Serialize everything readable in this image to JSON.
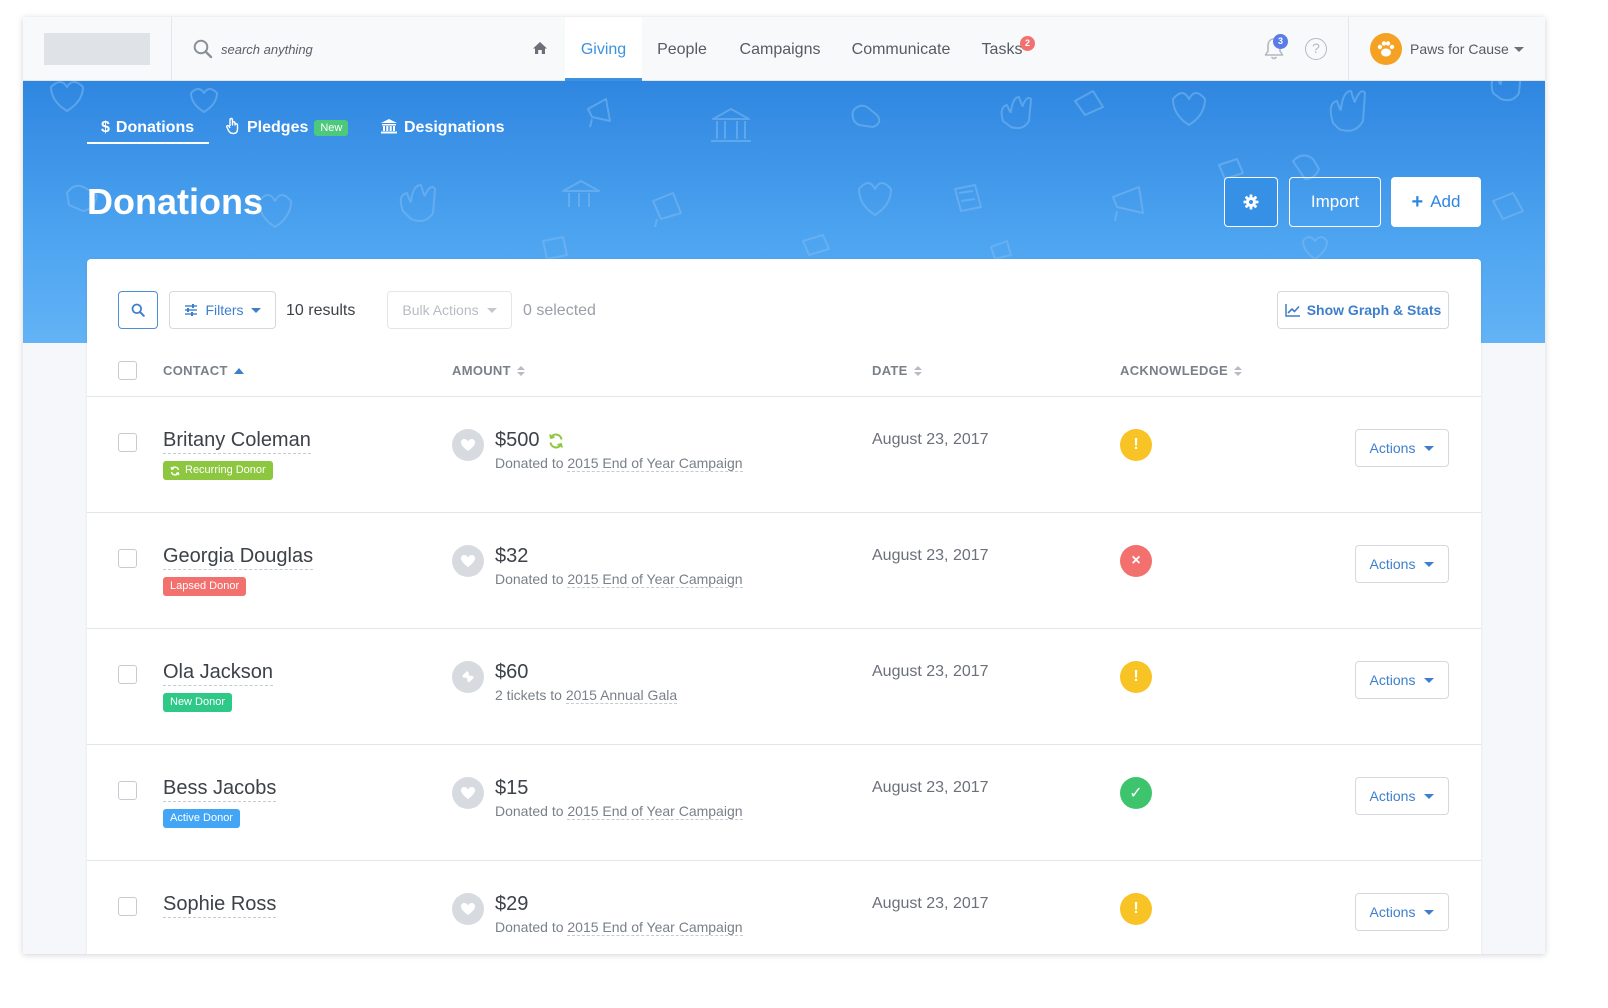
{
  "search": {
    "placeholder": "search anything"
  },
  "nav": {
    "tabs": [
      {
        "label": "Giving",
        "active": true
      },
      {
        "label": "People"
      },
      {
        "label": "Campaigns"
      },
      {
        "label": "Communicate"
      },
      {
        "label": "Tasks",
        "badge": "2"
      }
    ],
    "notifications_badge": "3",
    "help_symbol": "?",
    "org_name": "Paws for Cause"
  },
  "subtabs": {
    "donations": "Donations",
    "donations_symbol": "$",
    "pledges": "Pledges",
    "pledges_badge": "New",
    "designations": "Designations"
  },
  "page": {
    "title": "Donations",
    "import_label": "Import",
    "add_label": "Add",
    "add_symbol": "+"
  },
  "toolbar": {
    "filters_label": "Filters",
    "results_text": "10 results",
    "bulk_label": "Bulk Actions",
    "selected_text": "0 selected",
    "graph_label": "Show Graph & Stats"
  },
  "table": {
    "headers": {
      "contact": "CONTACT",
      "amount": "AMOUNT",
      "date": "DATE",
      "acknowledge": "ACKNOWLEDGE"
    },
    "rows": [
      {
        "name": "Britany Coleman",
        "tag": "Recurring Donor",
        "amount": "$500",
        "desc_prefix": "Donated to",
        "desc_link": "2015 End of Year Campaign",
        "date": "August 23, 2017",
        "ack_symbol": "!",
        "actions": "Actions"
      },
      {
        "name": "Georgia Douglas",
        "tag": "Lapsed Donor",
        "amount": "$32",
        "desc_prefix": "Donated to",
        "desc_link": "2015 End of Year Campaign",
        "date": "August 23, 2017",
        "ack_symbol": "×",
        "actions": "Actions"
      },
      {
        "name": "Ola Jackson",
        "tag": "New Donor",
        "amount": "$60",
        "desc_prefix": "2 tickets to",
        "desc_link": "2015 Annual Gala",
        "date": "August 23, 2017",
        "ack_symbol": "!",
        "actions": "Actions"
      },
      {
        "name": "Bess Jacobs",
        "tag": "Active Donor",
        "amount": "$15",
        "desc_prefix": "Donated to",
        "desc_link": "2015 End of Year Campaign",
        "date": "August 23, 2017",
        "ack_symbol": "✓",
        "actions": "Actions"
      },
      {
        "name": "Sophie Ross",
        "tag": "",
        "amount": "$29",
        "desc_prefix": "Donated to",
        "desc_link": "2015 End of Year Campaign",
        "date": "August 23, 2017",
        "ack_symbol": "!",
        "actions": "Actions"
      }
    ]
  },
  "colors": {
    "accent": "#3d92e0",
    "recurring": "#8dc63f",
    "lapsed": "#f2706e",
    "new": "#2ec987",
    "active": "#42a5f5",
    "ack_pending": "#f7c325",
    "ack_failed": "#f2706e",
    "ack_done": "#3ec46d"
  }
}
